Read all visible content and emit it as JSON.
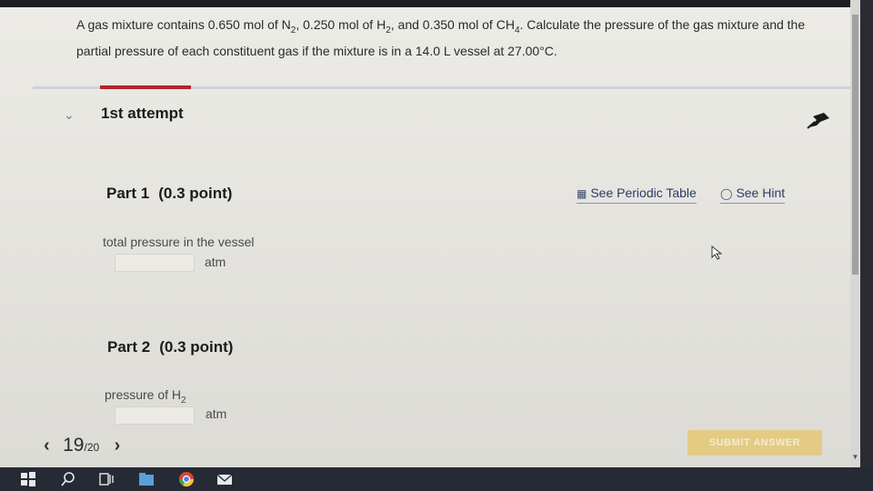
{
  "question": {
    "p1": "A gas mixture contains 0.650  mol of N",
    "p1_sub": "2",
    "p2": ", 0.250  mol of H",
    "p2_sub": "2",
    "p3": ", and 0.350  mol of CH",
    "p3_sub": "4",
    "p4": ". Calculate the pressure of the gas mixture and the partial pressure of each constituent gas if the mixture is in a 14.0  L vessel at 27.00°C."
  },
  "attempt": {
    "label": "1st attempt"
  },
  "part1": {
    "title": "Part 1",
    "points": "(0.3 point)",
    "field_label": "total pressure in the vessel",
    "unit": "atm",
    "input_value": ""
  },
  "part2": {
    "title": "Part 2",
    "points": "(0.3 point)",
    "field_label": "pressure of H",
    "field_label_sub": "2",
    "unit": "atm",
    "input_value": ""
  },
  "tools": {
    "periodic_table": "See Periodic Table",
    "hint": "See Hint"
  },
  "pager": {
    "current": "19",
    "total": "/20",
    "prev_icon": "‹",
    "next_icon": "›"
  },
  "submit": {
    "label": "SUBMIT ANSWER"
  },
  "colors": {
    "accent": "#b3242a",
    "submit_bg": "#e3cb84",
    "link": "#2d3c66"
  },
  "icons": [
    "chevron-down-icon",
    "pin-icon",
    "periodic-table-icon",
    "hint-bulb-icon",
    "mouse-cursor-icon",
    "windows-start-icon",
    "search-icon",
    "task-view-icon",
    "file-explorer-icon",
    "chrome-icon",
    "mail-icon"
  ]
}
